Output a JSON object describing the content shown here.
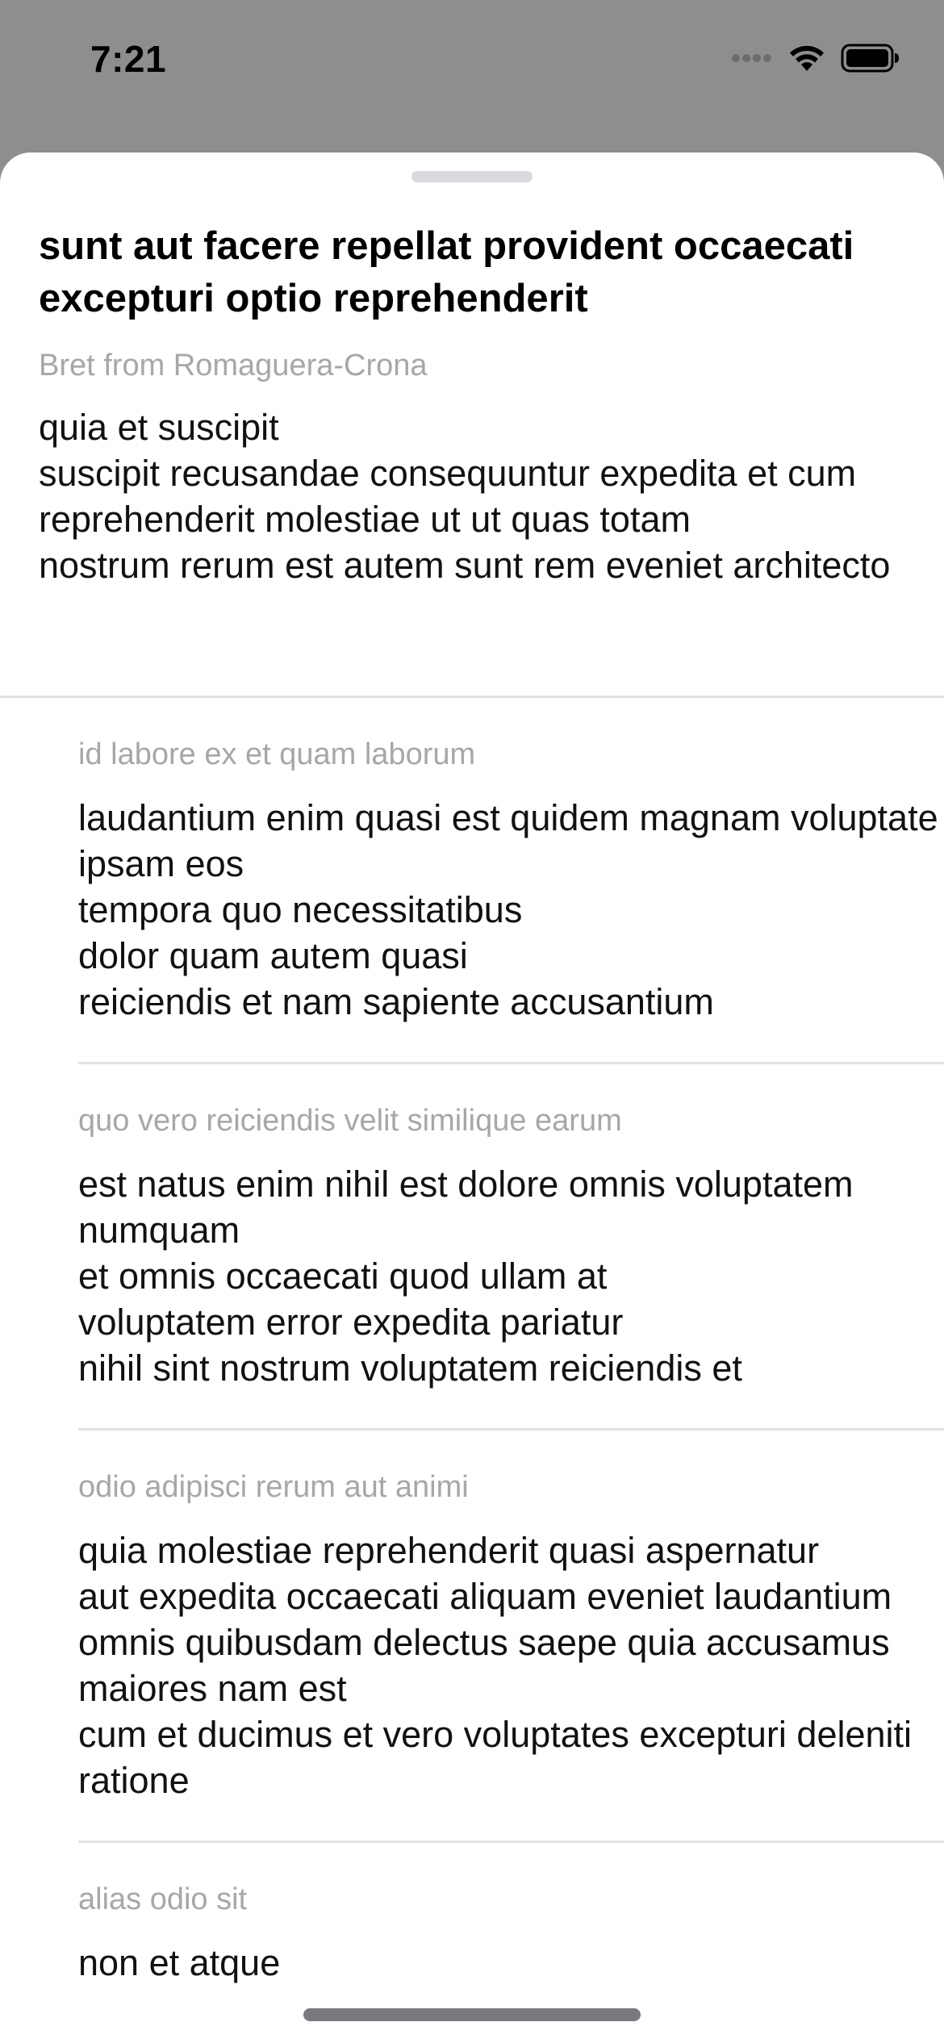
{
  "status_bar": {
    "time": "7:21",
    "icons": [
      "signal-icon",
      "wifi-icon",
      "battery-icon"
    ]
  },
  "post": {
    "title": "sunt aut facere repellat provident occaecati excepturi optio reprehenderit",
    "author": "Bret from Romaguera-Crona",
    "body": "quia et suscipit\nsuscipit recusandae consequuntur expedita et cum\nreprehenderit molestiae ut ut quas totam\nnostrum rerum est autem sunt rem eveniet architecto"
  },
  "comments": [
    {
      "name": "id labore ex et quam laborum",
      "body": "laudantium enim quasi est quidem magnam voluptate ipsam eos\ntempora quo necessitatibus\ndolor quam autem quasi\nreiciendis et nam sapiente accusantium"
    },
    {
      "name": "quo vero reiciendis velit similique earum",
      "body": "est natus enim nihil est dolore omnis voluptatem numquam\net omnis occaecati quod ullam at\nvoluptatem error expedita pariatur\nnihil sint nostrum voluptatem reiciendis et"
    },
    {
      "name": "odio adipisci rerum aut animi",
      "body": "quia molestiae reprehenderit quasi aspernatur\naut expedita occaecati aliquam eveniet laudantium\nomnis quibusdam delectus saepe quia accusamus maiores nam est\ncum et ducimus et vero voluptates excepturi deleniti ratione"
    },
    {
      "name": "alias odio sit",
      "body": "non et atque"
    }
  ],
  "colors": {
    "backdrop": "#8e8e8e",
    "sheet": "#ffffff",
    "secondary_text": "#a7a7ab",
    "divider": "#e2e2e6"
  }
}
